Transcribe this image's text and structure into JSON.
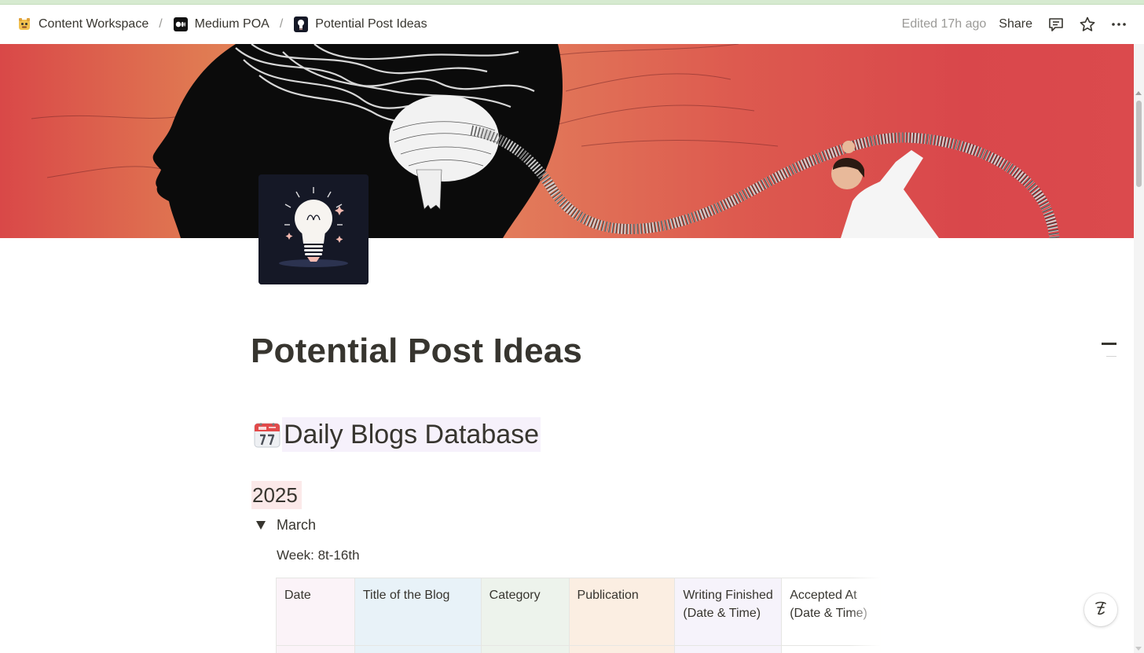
{
  "breadcrumbs": [
    {
      "label": "Content Workspace",
      "icon": "workspace-emoji-icon"
    },
    {
      "label": "Medium POA",
      "icon": "medium-logo-icon"
    },
    {
      "label": "Potential Post Ideas",
      "icon": "lightbulb-icon"
    }
  ],
  "breadcrumb_separator": "/",
  "topbar": {
    "edited": "Edited 17h ago",
    "share": "Share"
  },
  "page": {
    "title": "Potential Post Ideas"
  },
  "content": {
    "heading_emoji": "calendar-icon",
    "heading": "Daily Blogs Database",
    "year": "2025",
    "month_toggle": "March",
    "week": "Week: 8t-16th"
  },
  "table": {
    "columns": [
      {
        "label": "Date",
        "color": "#fbf3f8"
      },
      {
        "label": "Title of the Blog",
        "color": "#e8f2f8"
      },
      {
        "label": "Category",
        "color": "#edf3ec"
      },
      {
        "label": "Publication",
        "color": "#fbeee2"
      },
      {
        "label": "Writing Finished (Date & Time)",
        "color": "#f6f3fb"
      },
      {
        "label": "Accepted At (Date & Time)",
        "color": "#ffffff"
      }
    ]
  },
  "colors": {
    "accent_highlight_purple": "#f6f1fb",
    "accent_highlight_red": "#fbe9e9",
    "text": "#37352f",
    "muted": "#9b9a97"
  }
}
